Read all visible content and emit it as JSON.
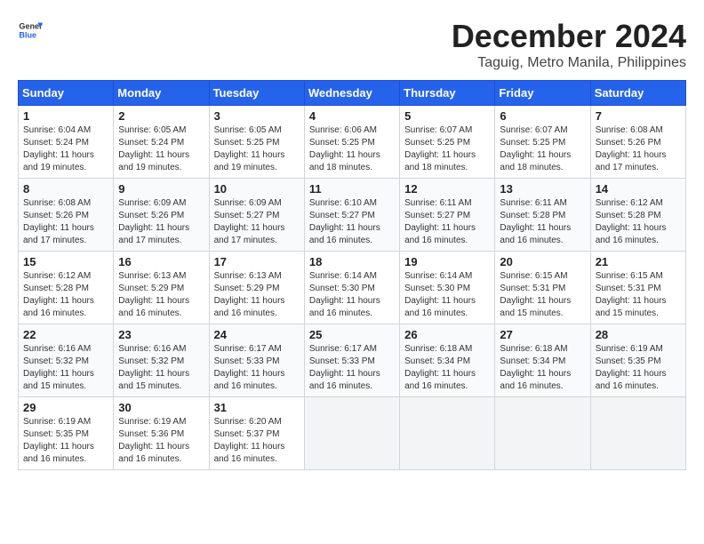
{
  "header": {
    "logo_general": "General",
    "logo_blue": "Blue",
    "month_title": "December 2024",
    "location": "Taguig, Metro Manila, Philippines"
  },
  "calendar": {
    "days_of_week": [
      "Sunday",
      "Monday",
      "Tuesday",
      "Wednesday",
      "Thursday",
      "Friday",
      "Saturday"
    ],
    "weeks": [
      [
        null,
        null,
        null,
        null,
        null,
        null,
        null
      ]
    ],
    "cells": [
      {
        "day": "",
        "empty": true
      },
      {
        "day": "",
        "empty": true
      },
      {
        "day": "",
        "empty": true
      },
      {
        "day": "",
        "empty": true
      },
      {
        "day": "",
        "empty": true
      },
      {
        "day": "",
        "empty": true
      },
      {
        "day": "",
        "empty": true
      }
    ]
  },
  "days": [
    {
      "num": "1",
      "sunrise": "6:04 AM",
      "sunset": "5:24 PM",
      "daylight": "11 hours and 19 minutes."
    },
    {
      "num": "2",
      "sunrise": "6:05 AM",
      "sunset": "5:24 PM",
      "daylight": "11 hours and 19 minutes."
    },
    {
      "num": "3",
      "sunrise": "6:05 AM",
      "sunset": "5:25 PM",
      "daylight": "11 hours and 19 minutes."
    },
    {
      "num": "4",
      "sunrise": "6:06 AM",
      "sunset": "5:25 PM",
      "daylight": "11 hours and 18 minutes."
    },
    {
      "num": "5",
      "sunrise": "6:07 AM",
      "sunset": "5:25 PM",
      "daylight": "11 hours and 18 minutes."
    },
    {
      "num": "6",
      "sunrise": "6:07 AM",
      "sunset": "5:25 PM",
      "daylight": "11 hours and 18 minutes."
    },
    {
      "num": "7",
      "sunrise": "6:08 AM",
      "sunset": "5:26 PM",
      "daylight": "11 hours and 17 minutes."
    },
    {
      "num": "8",
      "sunrise": "6:08 AM",
      "sunset": "5:26 PM",
      "daylight": "11 hours and 17 minutes."
    },
    {
      "num": "9",
      "sunrise": "6:09 AM",
      "sunset": "5:26 PM",
      "daylight": "11 hours and 17 minutes."
    },
    {
      "num": "10",
      "sunrise": "6:09 AM",
      "sunset": "5:27 PM",
      "daylight": "11 hours and 17 minutes."
    },
    {
      "num": "11",
      "sunrise": "6:10 AM",
      "sunset": "5:27 PM",
      "daylight": "11 hours and 16 minutes."
    },
    {
      "num": "12",
      "sunrise": "6:11 AM",
      "sunset": "5:27 PM",
      "daylight": "11 hours and 16 minutes."
    },
    {
      "num": "13",
      "sunrise": "6:11 AM",
      "sunset": "5:28 PM",
      "daylight": "11 hours and 16 minutes."
    },
    {
      "num": "14",
      "sunrise": "6:12 AM",
      "sunset": "5:28 PM",
      "daylight": "11 hours and 16 minutes."
    },
    {
      "num": "15",
      "sunrise": "6:12 AM",
      "sunset": "5:28 PM",
      "daylight": "11 hours and 16 minutes."
    },
    {
      "num": "16",
      "sunrise": "6:13 AM",
      "sunset": "5:29 PM",
      "daylight": "11 hours and 16 minutes."
    },
    {
      "num": "17",
      "sunrise": "6:13 AM",
      "sunset": "5:29 PM",
      "daylight": "11 hours and 16 minutes."
    },
    {
      "num": "18",
      "sunrise": "6:14 AM",
      "sunset": "5:30 PM",
      "daylight": "11 hours and 16 minutes."
    },
    {
      "num": "19",
      "sunrise": "6:14 AM",
      "sunset": "5:30 PM",
      "daylight": "11 hours and 16 minutes."
    },
    {
      "num": "20",
      "sunrise": "6:15 AM",
      "sunset": "5:31 PM",
      "daylight": "11 hours and 15 minutes."
    },
    {
      "num": "21",
      "sunrise": "6:15 AM",
      "sunset": "5:31 PM",
      "daylight": "11 hours and 15 minutes."
    },
    {
      "num": "22",
      "sunrise": "6:16 AM",
      "sunset": "5:32 PM",
      "daylight": "11 hours and 15 minutes."
    },
    {
      "num": "23",
      "sunrise": "6:16 AM",
      "sunset": "5:32 PM",
      "daylight": "11 hours and 15 minutes."
    },
    {
      "num": "24",
      "sunrise": "6:17 AM",
      "sunset": "5:33 PM",
      "daylight": "11 hours and 16 minutes."
    },
    {
      "num": "25",
      "sunrise": "6:17 AM",
      "sunset": "5:33 PM",
      "daylight": "11 hours and 16 minutes."
    },
    {
      "num": "26",
      "sunrise": "6:18 AM",
      "sunset": "5:34 PM",
      "daylight": "11 hours and 16 minutes."
    },
    {
      "num": "27",
      "sunrise": "6:18 AM",
      "sunset": "5:34 PM",
      "daylight": "11 hours and 16 minutes."
    },
    {
      "num": "28",
      "sunrise": "6:19 AM",
      "sunset": "5:35 PM",
      "daylight": "11 hours and 16 minutes."
    },
    {
      "num": "29",
      "sunrise": "6:19 AM",
      "sunset": "5:35 PM",
      "daylight": "11 hours and 16 minutes."
    },
    {
      "num": "30",
      "sunrise": "6:19 AM",
      "sunset": "5:36 PM",
      "daylight": "11 hours and 16 minutes."
    },
    {
      "num": "31",
      "sunrise": "6:20 AM",
      "sunset": "5:37 PM",
      "daylight": "11 hours and 16 minutes."
    }
  ],
  "labels": {
    "sunrise": "Sunrise:",
    "sunset": "Sunset:",
    "daylight": "Daylight:"
  }
}
